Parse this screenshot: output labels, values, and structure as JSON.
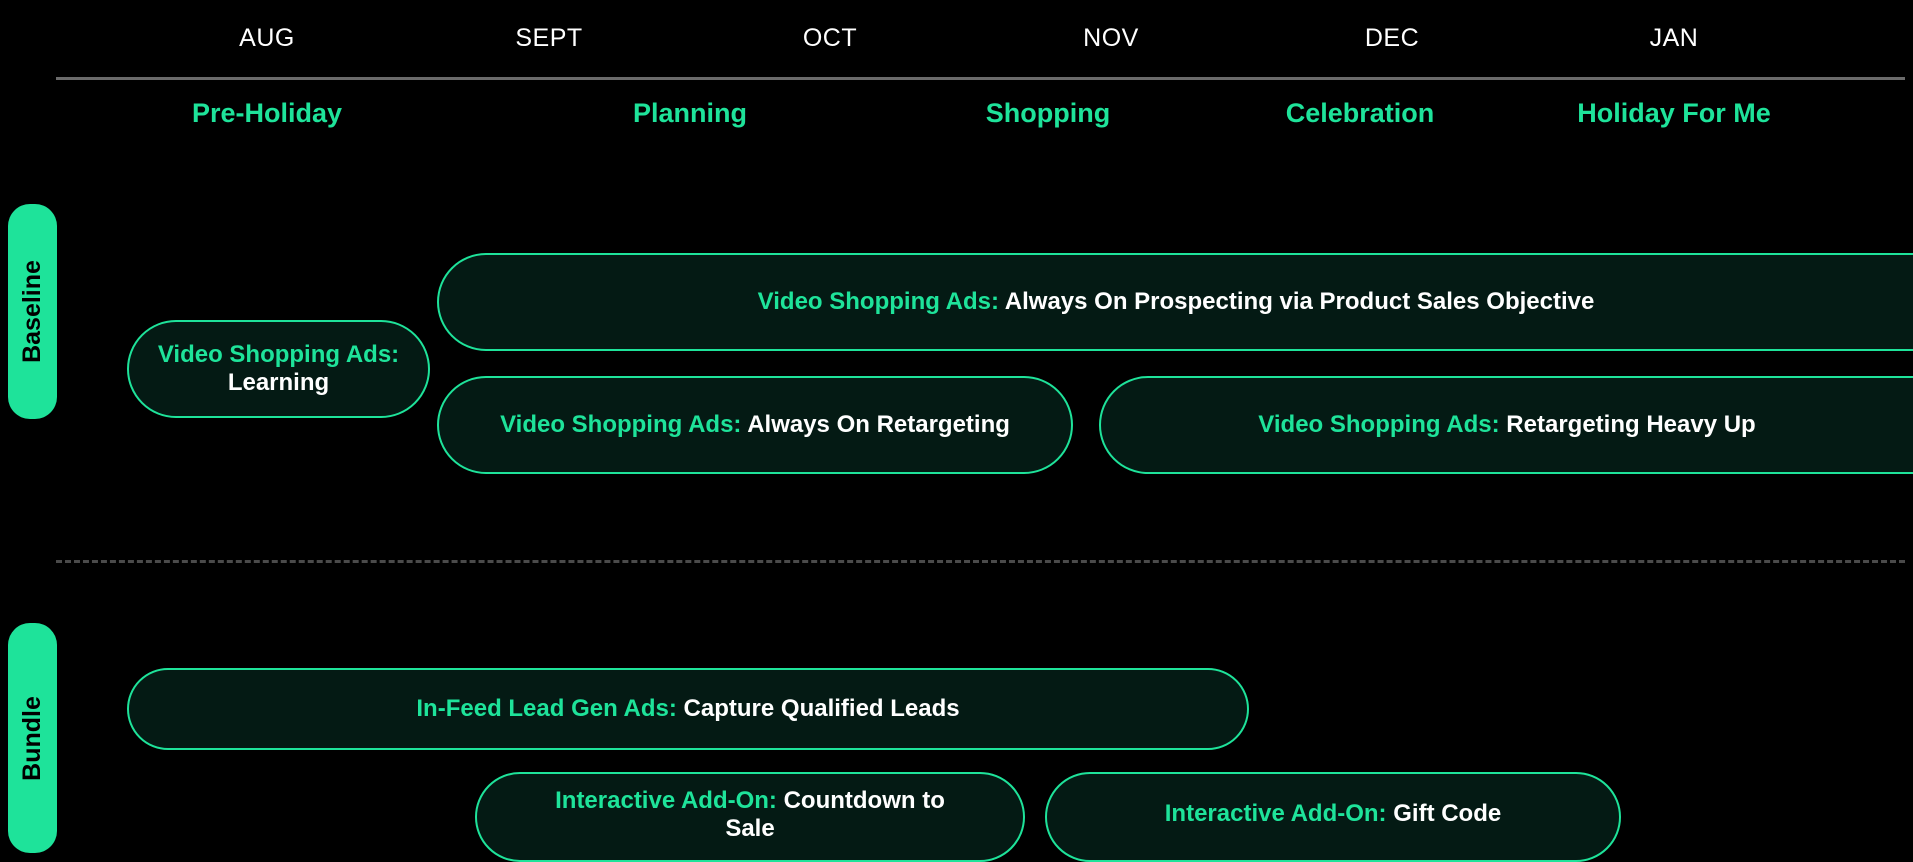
{
  "months": [
    "AUG",
    "SEPT",
    "OCT",
    "NOV",
    "DEC",
    "JAN"
  ],
  "phases": [
    "Pre-Holiday",
    "Planning",
    "Shopping",
    "Celebration",
    "Holiday For Me"
  ],
  "sections": {
    "baseline": "Baseline",
    "bundle": "Bundle"
  },
  "tactics": {
    "vsa_learning": {
      "highlight": "Video Shopping Ads:",
      "text": "Learning"
    },
    "vsa_prospecting": {
      "highlight": "Video Shopping Ads:",
      "text": "Always On Prospecting via Product Sales Objective"
    },
    "vsa_retargeting": {
      "highlight": "Video Shopping Ads:",
      "text": "Always On  Retargeting"
    },
    "vsa_heavy_up": {
      "highlight": "Video Shopping Ads:",
      "text": "Retargeting Heavy Up"
    },
    "lead_gen": {
      "highlight": "In-Feed Lead Gen Ads:",
      "text": "Capture Qualified Leads"
    },
    "countdown": {
      "highlight": "Interactive Add-On:",
      "text": "Countdown to Sale"
    },
    "gift_code": {
      "highlight": "Interactive Add-On:",
      "text": "Gift Code"
    }
  },
  "colors": {
    "accent": "#1ee39a",
    "pill_bg": "#041a14",
    "background": "#000000"
  }
}
